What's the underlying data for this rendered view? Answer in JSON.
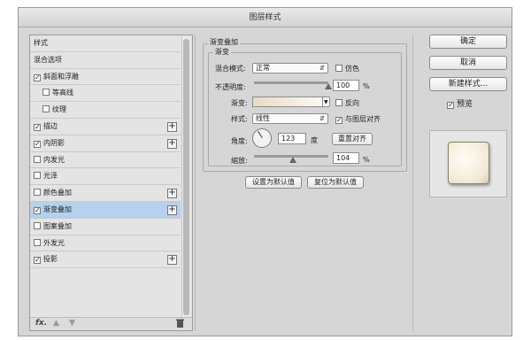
{
  "window": {
    "title": "图层样式"
  },
  "styles_list": [
    {
      "label": "样式",
      "checkbox": false,
      "checked": false,
      "indent": false,
      "add": false,
      "selected": false
    },
    {
      "label": "混合选项",
      "checkbox": false,
      "checked": false,
      "indent": false,
      "add": false,
      "selected": false
    },
    {
      "label": "斜面和浮雕",
      "checkbox": true,
      "checked": true,
      "indent": false,
      "add": false,
      "selected": false
    },
    {
      "label": "等高线",
      "checkbox": true,
      "checked": false,
      "indent": true,
      "add": false,
      "selected": false
    },
    {
      "label": "纹理",
      "checkbox": true,
      "checked": false,
      "indent": true,
      "add": false,
      "selected": false
    },
    {
      "label": "描边",
      "checkbox": true,
      "checked": true,
      "indent": false,
      "add": true,
      "selected": false
    },
    {
      "label": "内阴影",
      "checkbox": true,
      "checked": true,
      "indent": false,
      "add": true,
      "selected": false
    },
    {
      "label": "内发光",
      "checkbox": true,
      "checked": false,
      "indent": false,
      "add": false,
      "selected": false
    },
    {
      "label": "光泽",
      "checkbox": true,
      "checked": false,
      "indent": false,
      "add": false,
      "selected": false
    },
    {
      "label": "颜色叠加",
      "checkbox": true,
      "checked": false,
      "indent": false,
      "add": true,
      "selected": false
    },
    {
      "label": "渐变叠加",
      "checkbox": true,
      "checked": true,
      "indent": false,
      "add": true,
      "selected": true
    },
    {
      "label": "图案叠加",
      "checkbox": true,
      "checked": false,
      "indent": false,
      "add": false,
      "selected": false
    },
    {
      "label": "外发光",
      "checkbox": true,
      "checked": false,
      "indent": false,
      "add": false,
      "selected": false
    },
    {
      "label": "投影",
      "checkbox": true,
      "checked": true,
      "indent": false,
      "add": true,
      "selected": false
    }
  ],
  "bottom_bar": {
    "fx_label": "fx.",
    "up_icon": "arrow-up-icon",
    "down_icon": "arrow-down-icon",
    "delete_icon": "trash-icon"
  },
  "gradient_overlay": {
    "section_title": "渐变叠加",
    "sub_title": "渐变",
    "blend_mode_label": "混合模式:",
    "blend_mode_value": "正常",
    "dither_label": "仿色",
    "dither_checked": false,
    "opacity_label": "不透明度:",
    "opacity_value": "100",
    "opacity_unit": "%",
    "opacity_fraction": 1.0,
    "gradient_label": "渐变:",
    "gradient_colors": [
      "#e7dcc4",
      "#fbf9f2"
    ],
    "reverse_label": "反向",
    "reverse_checked": false,
    "style_label": "样式:",
    "style_value": "线性",
    "align_label": "与图层对齐",
    "align_checked": true,
    "angle_label": "角度:",
    "angle_value": "123",
    "angle_unit": "度",
    "reset_align_label": "重置对齐",
    "scale_label": "缩放:",
    "scale_value": "104",
    "scale_unit": "%",
    "scale_fraction": 0.52,
    "set_default_label": "设置为默认值",
    "reset_default_label": "复位为默认值"
  },
  "right": {
    "ok_label": "确定",
    "cancel_label": "取消",
    "new_style_label": "新建样式...",
    "preview_label": "预览",
    "preview_checked": true
  }
}
